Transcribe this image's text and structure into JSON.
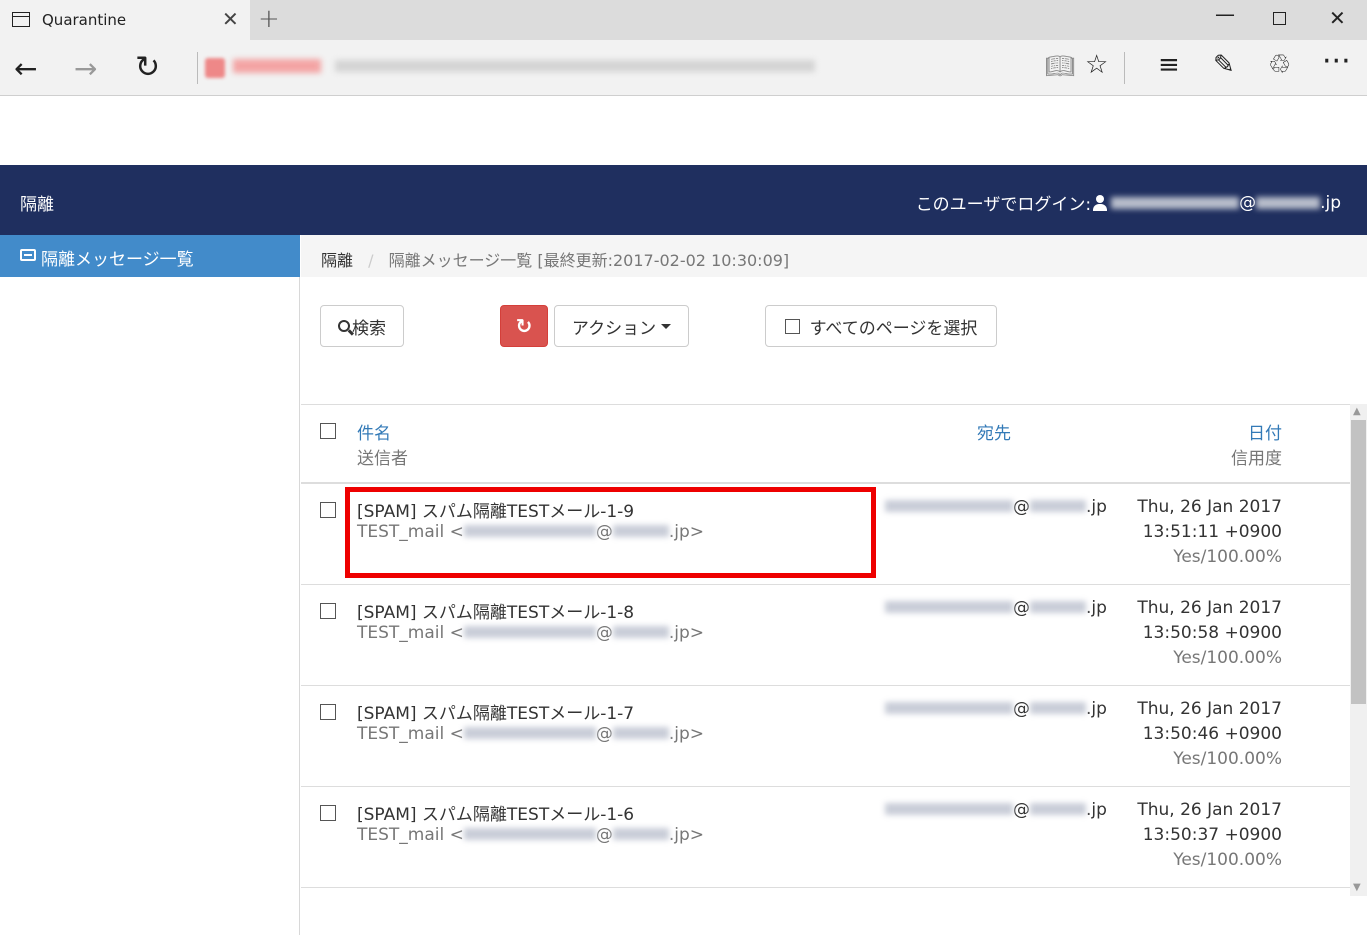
{
  "browser": {
    "tab_title": "Quarantine",
    "tab_close": "✕",
    "new_tab": "+",
    "win_min": "—",
    "win_close": "✕"
  },
  "header": {
    "brand": "隔離",
    "login_label": "このユーザでログイン:",
    "login_at": "@",
    "login_domain": ".jp"
  },
  "sidebar": {
    "items": [
      {
        "label": "隔離メッセージ一覧",
        "icon": "inbox-icon",
        "active": true
      }
    ]
  },
  "breadcrumb": {
    "home": "隔離",
    "separator": "/",
    "current": "隔離メッセージ一覧 [最終更新:2017-02-02 10:30:09]"
  },
  "toolbar": {
    "search_label": "検索",
    "refresh_icon": "↻",
    "action_label": "アクション",
    "select_all_label": "すべてのページを選択"
  },
  "table": {
    "columns": {
      "subject": "件名",
      "sender": "送信者",
      "recipient": "宛先",
      "date": "日付",
      "trust": "信用度"
    },
    "rows": [
      {
        "subject": "[SPAM] スパム隔離TESTメール-1-9",
        "sender_prefix": "TEST_mail <",
        "sender_at": "@",
        "sender_suffix": ".jp>",
        "recipient_at": "@",
        "recipient_suffix": ".jp",
        "date": "Thu, 26 Jan 2017",
        "time": "13:51:11 +0900",
        "trust": "Yes/100.00%"
      },
      {
        "subject": "[SPAM] スパム隔離TESTメール-1-8",
        "sender_prefix": "TEST_mail <",
        "sender_at": "@",
        "sender_suffix": ".jp>",
        "recipient_at": "@",
        "recipient_suffix": ".jp",
        "date": "Thu, 26 Jan 2017",
        "time": "13:50:58 +0900",
        "trust": "Yes/100.00%"
      },
      {
        "subject": "[SPAM] スパム隔離TESTメール-1-7",
        "sender_prefix": "TEST_mail <",
        "sender_at": "@",
        "sender_suffix": ".jp>",
        "recipient_at": "@",
        "recipient_suffix": ".jp",
        "date": "Thu, 26 Jan 2017",
        "time": "13:50:46 +0900",
        "trust": "Yes/100.00%"
      },
      {
        "subject": "[SPAM] スパム隔離TESTメール-1-6",
        "sender_prefix": "TEST_mail <",
        "sender_at": "@",
        "sender_suffix": ".jp>",
        "recipient_at": "@",
        "recipient_suffix": ".jp",
        "date": "Thu, 26 Jan 2017",
        "time": "13:50:37 +0900",
        "trust": "Yes/100.00%"
      }
    ]
  },
  "colors": {
    "header_bg": "#1f2f5f",
    "sidebar_active": "#428bca",
    "link": "#337ab7",
    "danger": "#d9534f",
    "highlight": "#ee0000"
  }
}
